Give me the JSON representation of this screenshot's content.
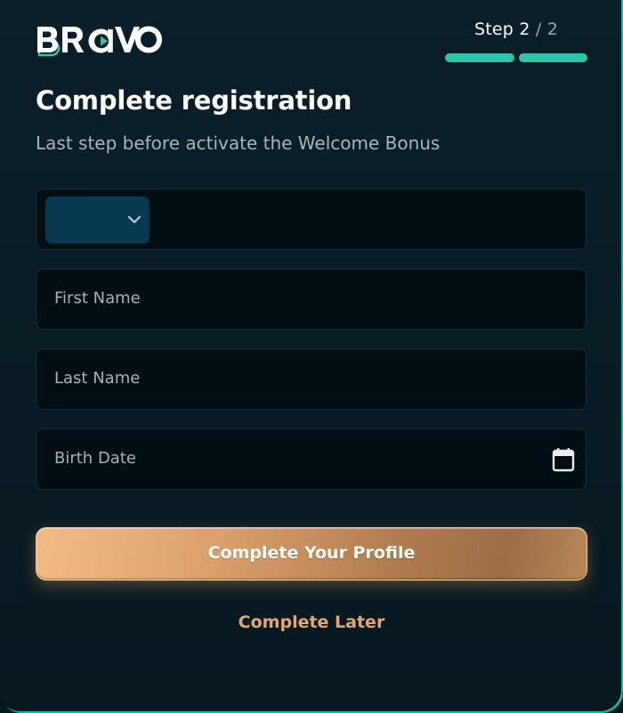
{
  "brand": {
    "logo_text": "BRAVO",
    "accent_color": "#2fc3a7"
  },
  "stepper": {
    "label": "Step",
    "current": "2",
    "separator": " / ",
    "total": "2",
    "segments_total": 2,
    "segments_completed": 2
  },
  "header": {
    "title": "Complete registration",
    "subtitle": "Last step before activate the Welcome Bonus"
  },
  "form": {
    "phone": {
      "country_icon": "chevron-down-icon",
      "value": ""
    },
    "first_name": {
      "placeholder": "First Name"
    },
    "last_name": {
      "placeholder": "Last Name"
    },
    "birth_date": {
      "placeholder": "Birth Date",
      "icon": "calendar-icon"
    }
  },
  "actions": {
    "primary_label": "Complete Your Profile",
    "secondary_label": "Complete Later"
  }
}
